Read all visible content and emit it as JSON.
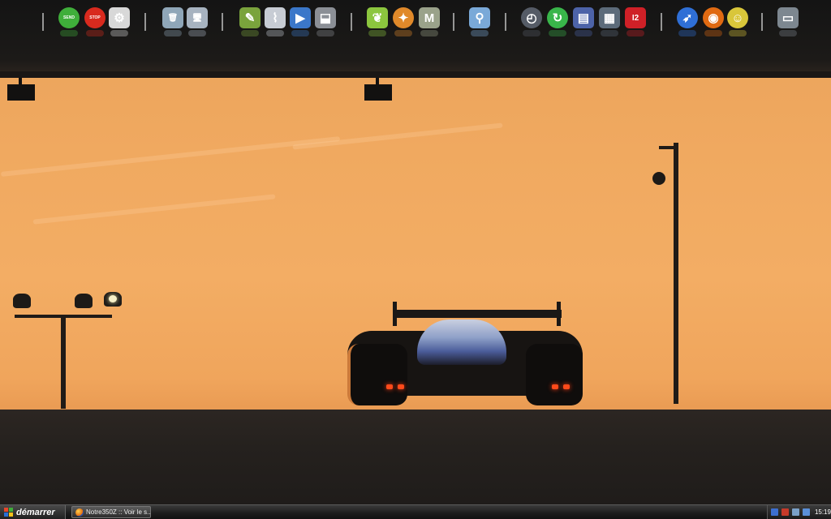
{
  "dock": {
    "icons": [
      {
        "name": "send-icon",
        "label": "SEND",
        "glyph": "●",
        "color": "#3fae3a"
      },
      {
        "name": "stop-icon",
        "label": "STOP",
        "glyph": "●",
        "color": "#d82a1e"
      },
      {
        "name": "gears-icon",
        "glyph": "⚙",
        "color": "#d8d8d8"
      },
      {
        "name": "recycle-bin-icon",
        "glyph": "🗑",
        "color": "#8fa6b8"
      },
      {
        "name": "my-computer-icon",
        "glyph": "🖥",
        "color": "#a7b3c0"
      },
      {
        "name": "paint-icon",
        "glyph": "✎",
        "color": "#7aa33c"
      },
      {
        "name": "broom-icon",
        "glyph": "⌇",
        "color": "#c7ccd4"
      },
      {
        "name": "media-icon",
        "glyph": "▶",
        "color": "#3b77c9"
      },
      {
        "name": "save-icon",
        "glyph": "⬓",
        "color": "#8b8f96"
      },
      {
        "name": "leaf-icon",
        "glyph": "❦",
        "color": "#8cc63e"
      },
      {
        "name": "ninja-icon",
        "glyph": "✦",
        "color": "#e0892a"
      },
      {
        "name": "m-icon",
        "glyph": "M",
        "color": "#9aa28a"
      },
      {
        "name": "search-icon",
        "glyph": "⚲",
        "color": "#7aa9d8"
      },
      {
        "name": "clock-icon",
        "glyph": "◴",
        "color": "#555b66"
      },
      {
        "name": "refresh-icon",
        "glyph": "↻",
        "color": "#39b54a"
      },
      {
        "name": "hardware-icon",
        "glyph": "▤",
        "color": "#4d63a8"
      },
      {
        "name": "registry-icon",
        "glyph": "▦",
        "color": "#5c6b7a"
      },
      {
        "name": "i2-pro-icon",
        "glyph": "I2",
        "color": "#cf2027"
      },
      {
        "name": "rocket-icon",
        "glyph": "➶",
        "color": "#2f6fd6"
      },
      {
        "name": "firefox-icon",
        "glyph": "◉",
        "color": "#e06a12"
      },
      {
        "name": "messenger-icon",
        "glyph": "☺",
        "color": "#d9c63a"
      },
      {
        "name": "drive-icon",
        "glyph": "▭",
        "color": "#7d8790"
      }
    ]
  },
  "taskbar": {
    "start_label": "démarrer",
    "task_item_label": "Notre350Z :: Voir le s...",
    "clock": "15:19"
  },
  "colors": {
    "sky": "#f3ad64",
    "taskbar": "#1e1e1e"
  }
}
